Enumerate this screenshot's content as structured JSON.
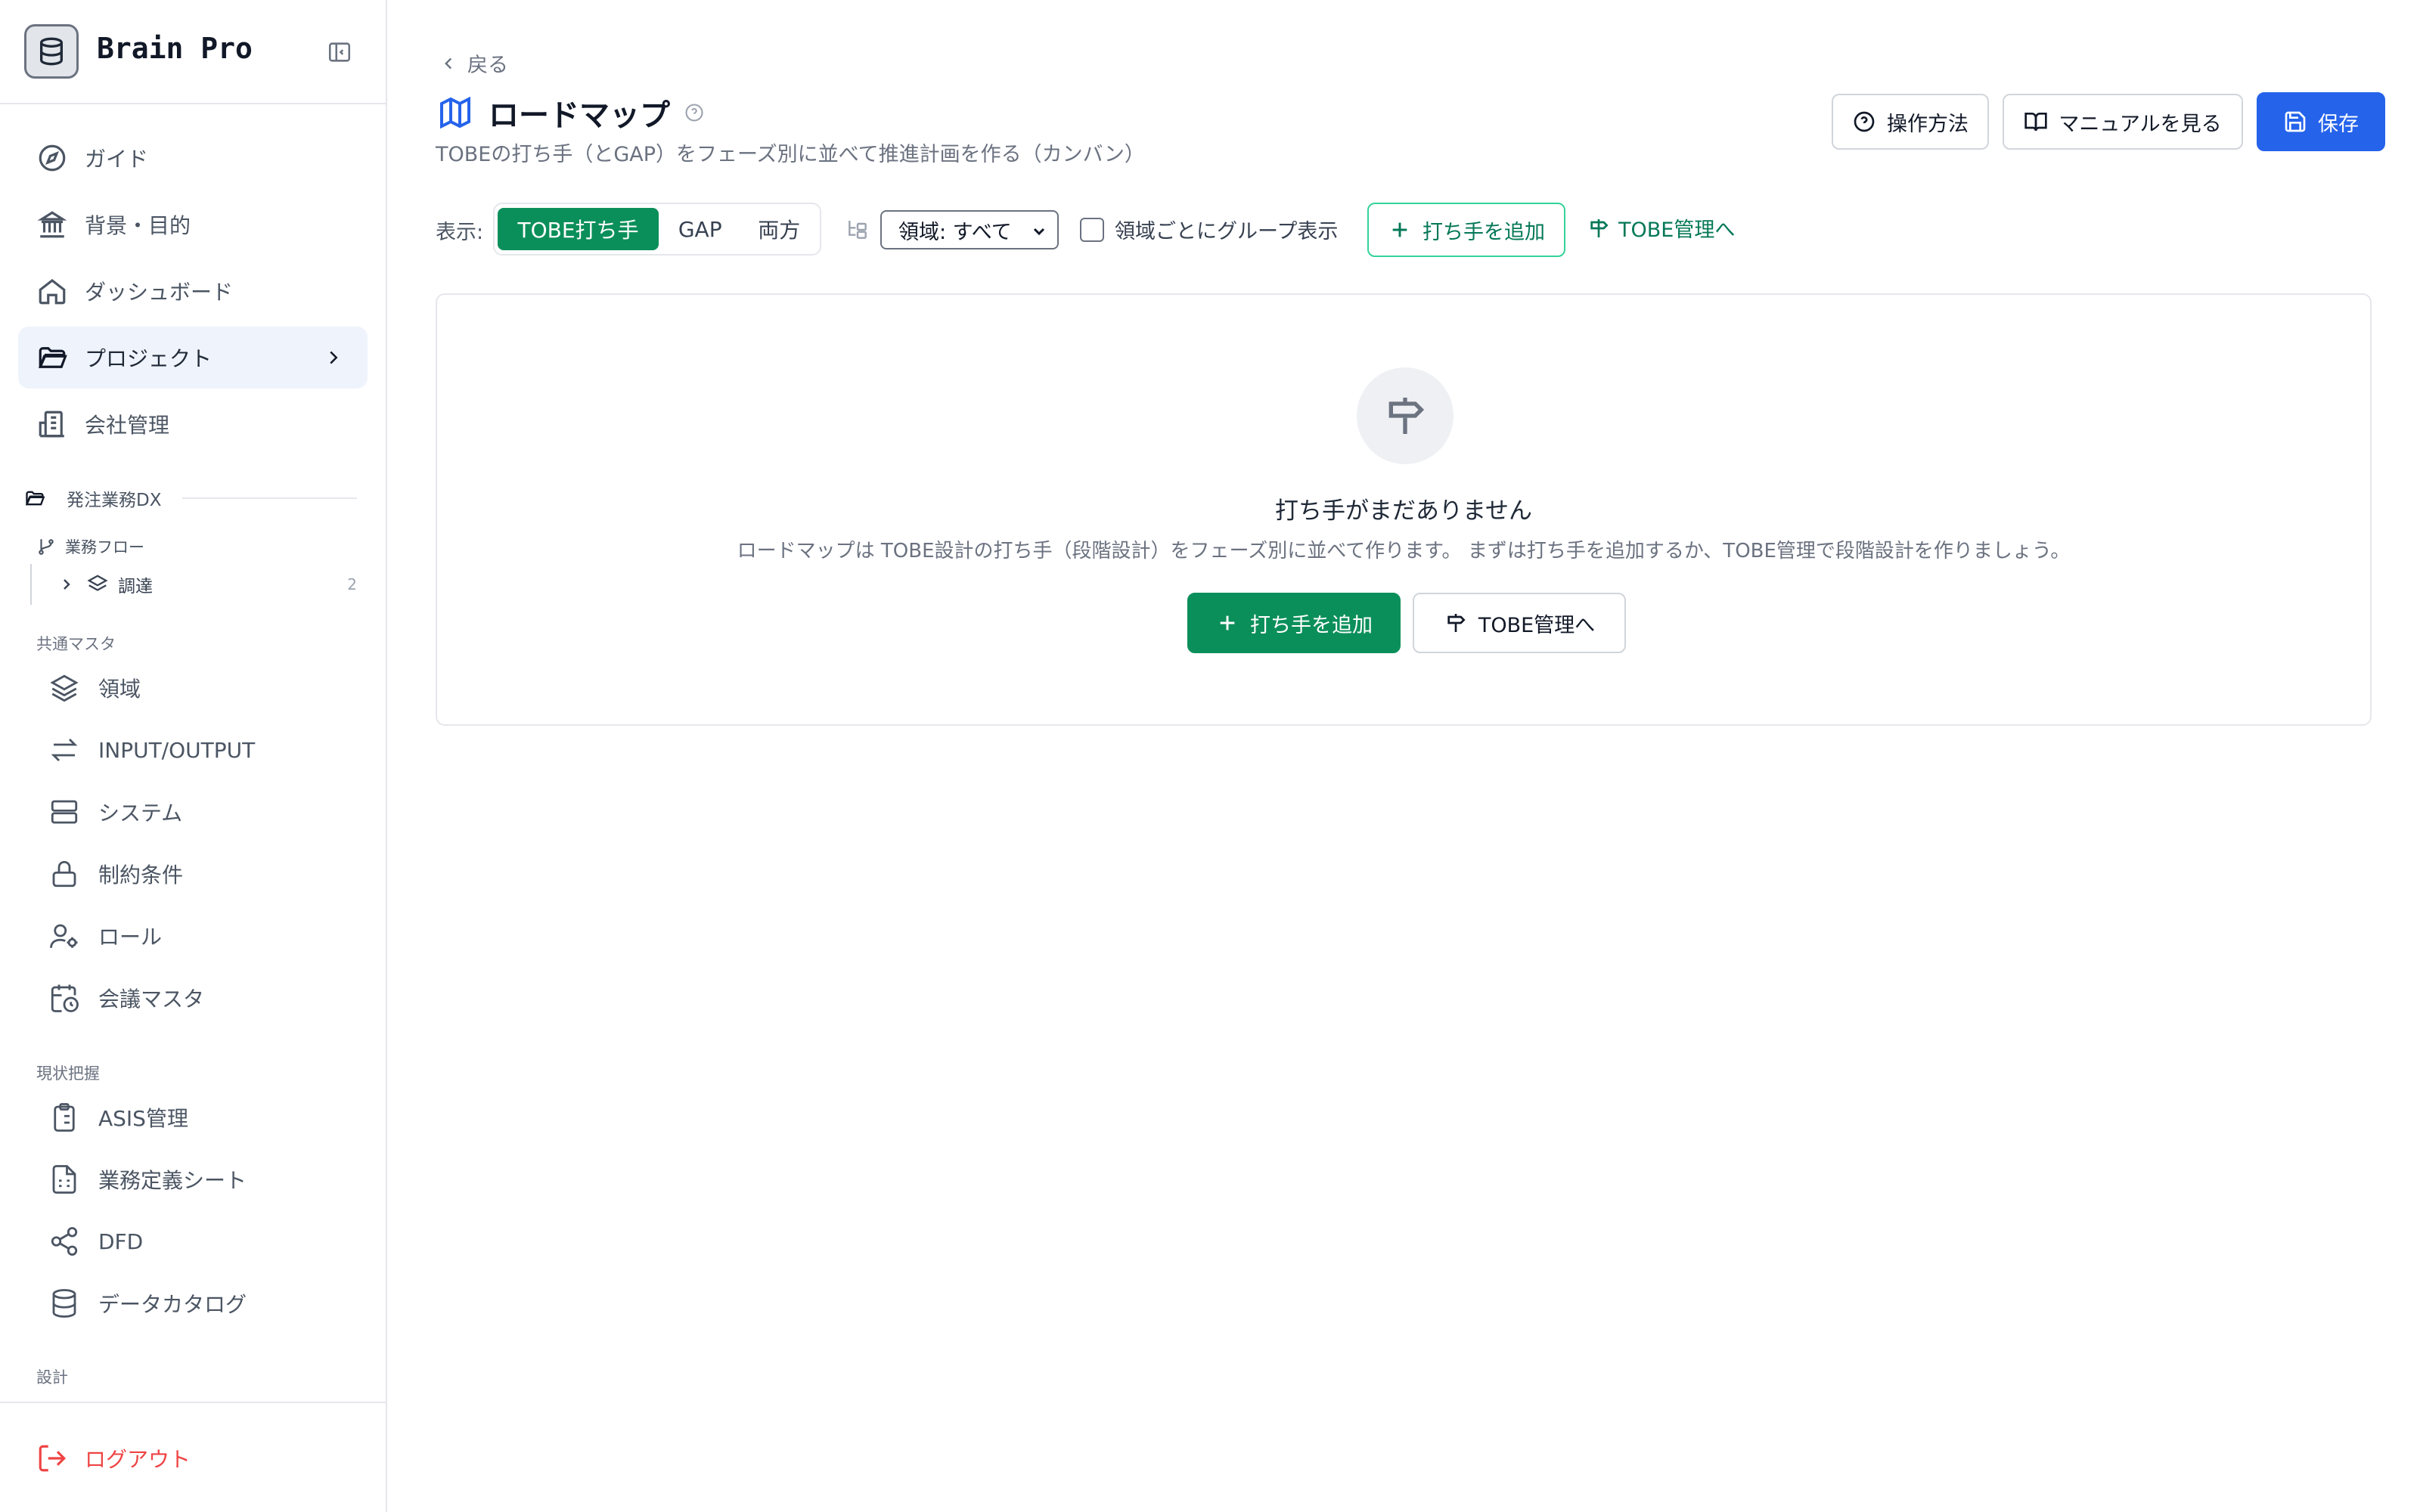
{
  "sidebar": {
    "brand": "Brain Pro",
    "nav": [
      {
        "label": "ガイド"
      },
      {
        "label": "背景・目的"
      },
      {
        "label": "ダッシュボード"
      },
      {
        "label": "プロジェクト"
      },
      {
        "label": "会社管理"
      }
    ],
    "project_name": "発注業務DX",
    "flow_label": "業務フロー",
    "flow_item": {
      "label": "調達",
      "count": "2"
    },
    "sections": {
      "common_master": "共通マスタ",
      "current_state": "現状把握",
      "design": "設計"
    },
    "common_items": [
      {
        "label": "領域"
      },
      {
        "label": "INPUT/OUTPUT"
      },
      {
        "label": "システム"
      },
      {
        "label": "制約条件"
      },
      {
        "label": "ロール"
      },
      {
        "label": "会議マスタ"
      }
    ],
    "current_items": [
      {
        "label": "ASIS管理"
      },
      {
        "label": "業務定義シート"
      },
      {
        "label": "DFD"
      },
      {
        "label": "データカタログ"
      }
    ],
    "logout": "ログアウト"
  },
  "header": {
    "back": "戻る",
    "title": "ロードマップ",
    "description": "TOBEの打ち手（とGAP）をフェーズ別に並べて推進計画を作る（カンバン）",
    "how_to": "操作方法",
    "manual": "マニュアルを見る",
    "save": "保存"
  },
  "toolbar": {
    "display_label": "表示:",
    "views": [
      "TOBE打ち手",
      "GAP",
      "両方"
    ],
    "active_view": "TOBE打ち手",
    "area_select": "領域: すべて",
    "group_by_area": "領域ごとにグループ表示",
    "add_action": "打ち手を追加",
    "to_tobe": "TOBE管理へ"
  },
  "empty_state": {
    "title": "打ち手がまだありません",
    "description": "ロードマップは TOBE設計の打ち手（段階設計）をフェーズ別に並べて作ります。 まずは打ち手を追加するか、TOBE管理で段階設計を作りましょう。",
    "add_button": "打ち手を追加",
    "tobe_button": "TOBE管理へ"
  },
  "colors": {
    "accent_green": "#0b8f5a",
    "primary_blue": "#2563eb",
    "danger_red": "#ef4444",
    "active_nav_bg": "#eff3fb"
  }
}
